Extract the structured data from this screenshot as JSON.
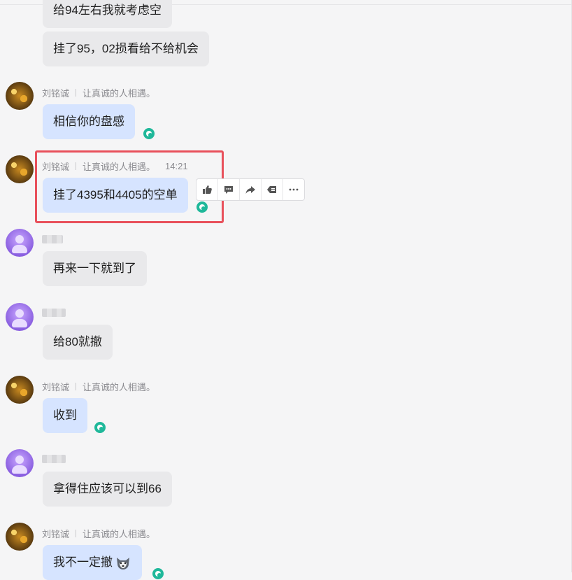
{
  "self": {
    "name": "刘铭诚",
    "signature": "让真诚的人相遇。"
  },
  "messages": [
    {
      "text": "给94左右我就考虑空"
    },
    {
      "text": "挂了95，02损看给不给机会"
    },
    {
      "text": "相信你的盘感"
    },
    {
      "text": "挂了4395和4405的空单",
      "time": "14:21"
    },
    {
      "text": "再来一下就到了"
    },
    {
      "text": "给80就撤"
    },
    {
      "text": "收到"
    },
    {
      "text": "拿得住应该可以到66"
    },
    {
      "text": "我不一定撤"
    }
  ],
  "hover_actions": [
    "thumbs-up-icon",
    "comment-icon",
    "forward-icon",
    "quote-icon",
    "more-icon"
  ],
  "colors": {
    "self_bubble": "#d6e4ff",
    "other_bubble": "#e9e9eb",
    "read_receipt": "#1fb89a",
    "highlight": "#e8505b"
  }
}
